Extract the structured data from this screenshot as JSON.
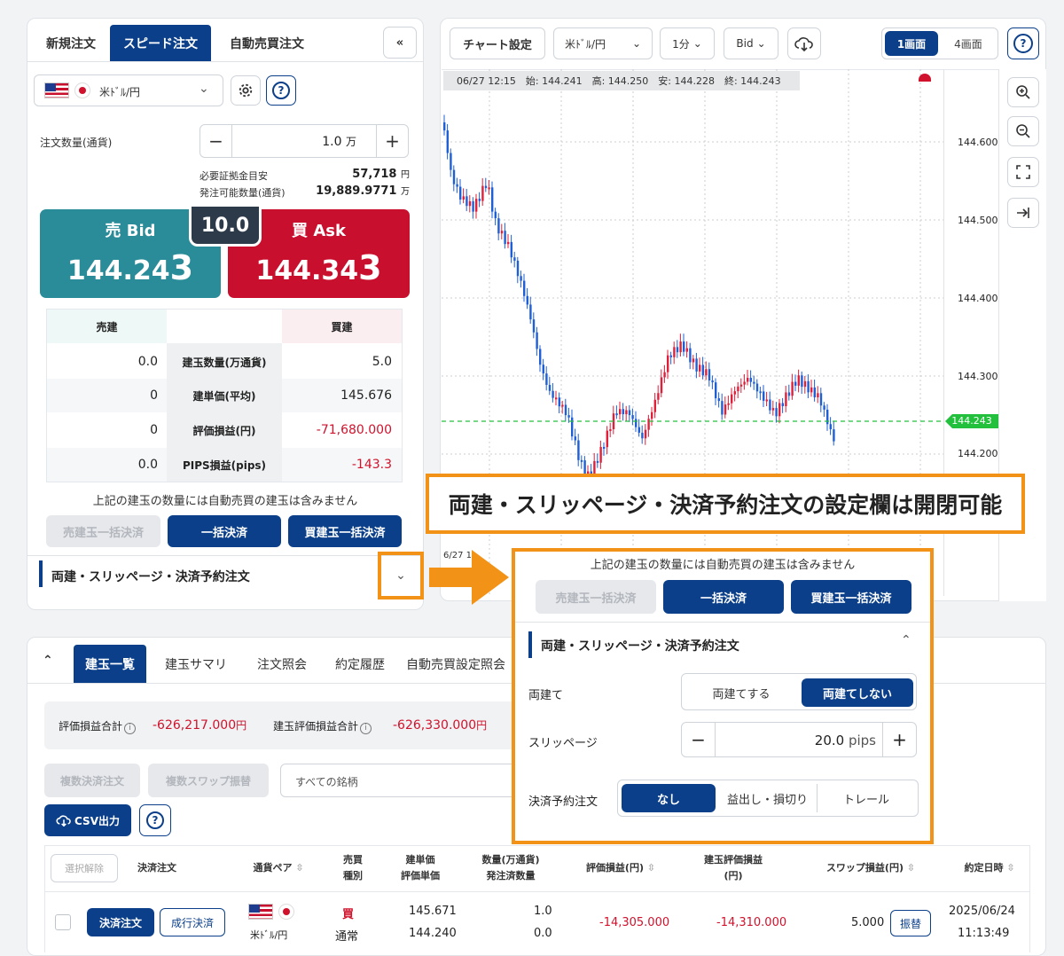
{
  "tabs": {
    "new_order": "新規注文",
    "speed_order": "スピード注文",
    "auto_order": "自動売買注文",
    "collapse": "«"
  },
  "pair": {
    "label": "米ﾄﾞﾙ/円"
  },
  "order": {
    "qty_label": "注文数量(通貨)",
    "qty_value": "1.0",
    "qty_unit": "万",
    "margin_label": "必要証拠金目安",
    "margin_value": "57,718",
    "margin_unit": "円",
    "available_label": "発注可能数量(通貨)",
    "available_value": "19,889.9771",
    "available_unit": "万"
  },
  "quote": {
    "bid_label": "売 Bid",
    "bid_main": "144.24",
    "bid_last": "3",
    "ask_label": "買 Ask",
    "ask_main": "144.34",
    "ask_last": "3",
    "spread": "10.0"
  },
  "positions": {
    "sell_header": "売建",
    "buy_header": "買建",
    "rows": [
      {
        "sell": "0.0",
        "label": "建玉数量(万通貨)",
        "buy": "5.0"
      },
      {
        "sell": "0",
        "label": "建単価(平均)",
        "buy": "145.676"
      },
      {
        "sell": "0",
        "label": "評価損益(円)",
        "buy": "-71,680.000"
      },
      {
        "sell": "0.0",
        "label": "PIPS損益(pips)",
        "buy": "-143.3"
      }
    ]
  },
  "note": "上記の建玉の数量には自動売買の建玉は含みません",
  "settle": {
    "sell_all": "売建玉一括決済",
    "all": "一括決済",
    "buy_all": "買建玉一括決済"
  },
  "section_title": "両建・スリッページ・決済予約注文",
  "chart": {
    "settings": "チャート設定",
    "pair": "米ﾄﾞﾙ/円",
    "interval": "1分",
    "side": "Bid",
    "view1": "1画面",
    "view4": "4画面",
    "info": "06/27 12:15　始: 144.241　高: 144.250　安: 144.228　終: 144.243",
    "ylabels": [
      "144.600",
      "144.500",
      "144.400",
      "144.300",
      "144.200"
    ],
    "current": "144.243",
    "xlabel": "6/27 1"
  },
  "callout": "両建・スリッページ・決済予約注文の設定欄は開閉可能",
  "popup": {
    "hedge_label": "両建て",
    "hedge_yes": "両建てする",
    "hedge_no": "両建てしない",
    "slip_label": "スリッページ",
    "slip_value": "20.0",
    "slip_unit": "pips",
    "reserve_label": "決済予約注文",
    "reserve_none": "なし",
    "reserve_tp": "益出し・損切り",
    "reserve_trail": "トレール"
  },
  "bottom": {
    "tabs": [
      "建玉一覧",
      "建玉サマリ",
      "注文照会",
      "約定履歴",
      "自動売買設定照会"
    ],
    "pl_label": "評価損益合計",
    "pl_value": "-626,217.000",
    "pl_unit": "円",
    "pos_pl_label": "建玉評価損益合計",
    "pos_pl_value": "-626,330.000",
    "pos_pl_unit": "円",
    "multi_settle": "複数決済注文",
    "multi_swap": "複数スワップ振替",
    "symbol_filter": "すべての銘柄",
    "csv": "CSV出力",
    "deselect": "選択解除",
    "headers": {
      "settle": "決済注文",
      "pair": "通貨ペア",
      "side1": "売買",
      "side2": "種別",
      "price1": "建単価",
      "price2": "評価単価",
      "qty1": "数量(万通貨)",
      "qty2": "発注済数量",
      "pl": "評価損益(円)",
      "pos_pl1": "建玉評価損益",
      "pos_pl2": "(円)",
      "swap": "スワップ損益(円)",
      "date": "約定日時"
    },
    "row": {
      "settle_btn": "決済注文",
      "market_btn": "成行決済",
      "pair": "米ﾄﾞﾙ/円",
      "side": "買",
      "type": "通常",
      "price": "145.671",
      "eval_price": "144.240",
      "qty": "1.0",
      "ordered": "0.0",
      "pl": "-14,305.000",
      "pos_pl": "-14,310.000",
      "swap": "5.000",
      "swap_btn": "振替",
      "date": "2025/06/24",
      "time": "11:13:49"
    }
  },
  "colors": {
    "bid": "#2a8c99",
    "ask": "#c8102e",
    "brand": "#0b3f8a",
    "callout": "#f29318",
    "up": "#e0203a",
    "down": "#1f5fd6"
  }
}
